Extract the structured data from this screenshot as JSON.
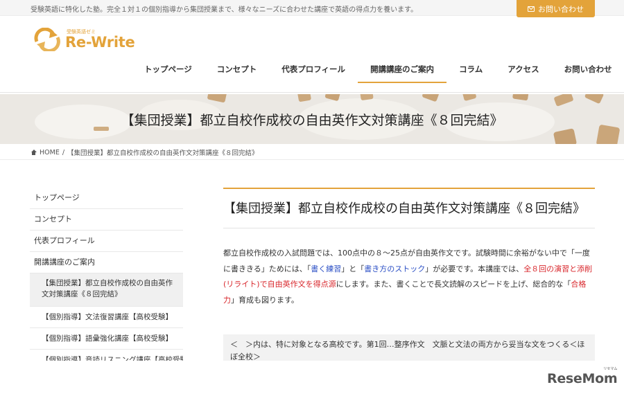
{
  "topbar": {
    "tagline": "受験英語に特化した塾。完全１対１の個別指導から集団授業まで、様々なニーズに合わせた講座で英語の得点力を養います。",
    "contact_label": "お問い合わせ"
  },
  "logo": {
    "sub": "受験英語ゼミ",
    "main": "Re-Write"
  },
  "nav": {
    "items": [
      {
        "label": "トップページ"
      },
      {
        "label": "コンセプト"
      },
      {
        "label": "代表プロフィール"
      },
      {
        "label": "開講講座のご案内",
        "active": true
      },
      {
        "label": "コラム"
      },
      {
        "label": "アクセス"
      },
      {
        "label": "お問い合わせ"
      }
    ]
  },
  "hero": {
    "title": "【集団授業】都立自校作成校の自由英作文対策講座《８回完結》"
  },
  "breadcrumb": {
    "home": "HOME",
    "separator": "/",
    "current": "【集団授業】都立自校作成校の自由英作文対策講座《８回完結》"
  },
  "sidebar": {
    "items": [
      {
        "label": "トップページ"
      },
      {
        "label": "コンセプト"
      },
      {
        "label": "代表プロフィール"
      },
      {
        "label": "開講講座のご案内"
      },
      {
        "label": "【集団授業】都立自校作成校の自由英作文対策講座《８回完結》"
      },
      {
        "label": "【個別指導】文法復習講座【高校受験】"
      },
      {
        "label": "【個別指導】語彙強化講座【高校受験】"
      },
      {
        "label": "【個別指導】音読リスニング講座【高校受験】"
      }
    ]
  },
  "article": {
    "title": "【集団授業】都立自校作成校の自由英作文対策講座《８回完結》",
    "lead": {
      "t1": "都立自校作成校の入試問題では、100点中の８～25点が自由英作文です。試験時間に余裕がない中で「一度に書ききる」ためには、「",
      "b1": "書く練習",
      "t2": "」と「",
      "b2": "書き方のストック",
      "t3": "」が必要です。本講座では、",
      "r1": "全８回の演習と添削(リライト)で自由英作文を得点源",
      "t4": "にします。また、書くことで長文読解のスピードを上げ、総合的な「",
      "r2": "合格力",
      "t5": "」育成も図ります。"
    },
    "note": "＜　＞内は、特に対象となる高校です。第1回…整序作文　文脈と文法の両方から妥当な文をつくる＜ほぼ全校＞"
  },
  "watermark": {
    "brand": "ReseMom",
    "kana": "リセマム"
  },
  "colors": {
    "accent": "#e3a33a",
    "blue_text": "#2b4fc5",
    "red_text": "#d8262b"
  }
}
